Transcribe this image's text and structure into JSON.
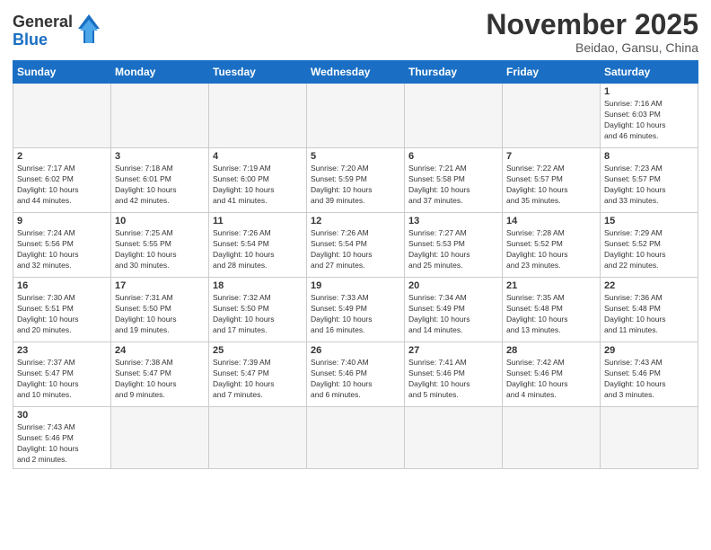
{
  "header": {
    "logo_general": "General",
    "logo_blue": "Blue",
    "month_title": "November 2025",
    "location": "Beidao, Gansu, China"
  },
  "weekdays": [
    "Sunday",
    "Monday",
    "Tuesday",
    "Wednesday",
    "Thursday",
    "Friday",
    "Saturday"
  ],
  "weeks": [
    [
      {
        "day": "",
        "info": ""
      },
      {
        "day": "",
        "info": ""
      },
      {
        "day": "",
        "info": ""
      },
      {
        "day": "",
        "info": ""
      },
      {
        "day": "",
        "info": ""
      },
      {
        "day": "",
        "info": ""
      },
      {
        "day": "1",
        "info": "Sunrise: 7:16 AM\nSunset: 6:03 PM\nDaylight: 10 hours\nand 46 minutes."
      }
    ],
    [
      {
        "day": "2",
        "info": "Sunrise: 7:17 AM\nSunset: 6:02 PM\nDaylight: 10 hours\nand 44 minutes."
      },
      {
        "day": "3",
        "info": "Sunrise: 7:18 AM\nSunset: 6:01 PM\nDaylight: 10 hours\nand 42 minutes."
      },
      {
        "day": "4",
        "info": "Sunrise: 7:19 AM\nSunset: 6:00 PM\nDaylight: 10 hours\nand 41 minutes."
      },
      {
        "day": "5",
        "info": "Sunrise: 7:20 AM\nSunset: 5:59 PM\nDaylight: 10 hours\nand 39 minutes."
      },
      {
        "day": "6",
        "info": "Sunrise: 7:21 AM\nSunset: 5:58 PM\nDaylight: 10 hours\nand 37 minutes."
      },
      {
        "day": "7",
        "info": "Sunrise: 7:22 AM\nSunset: 5:57 PM\nDaylight: 10 hours\nand 35 minutes."
      },
      {
        "day": "8",
        "info": "Sunrise: 7:23 AM\nSunset: 5:57 PM\nDaylight: 10 hours\nand 33 minutes."
      }
    ],
    [
      {
        "day": "9",
        "info": "Sunrise: 7:24 AM\nSunset: 5:56 PM\nDaylight: 10 hours\nand 32 minutes."
      },
      {
        "day": "10",
        "info": "Sunrise: 7:25 AM\nSunset: 5:55 PM\nDaylight: 10 hours\nand 30 minutes."
      },
      {
        "day": "11",
        "info": "Sunrise: 7:26 AM\nSunset: 5:54 PM\nDaylight: 10 hours\nand 28 minutes."
      },
      {
        "day": "12",
        "info": "Sunrise: 7:26 AM\nSunset: 5:54 PM\nDaylight: 10 hours\nand 27 minutes."
      },
      {
        "day": "13",
        "info": "Sunrise: 7:27 AM\nSunset: 5:53 PM\nDaylight: 10 hours\nand 25 minutes."
      },
      {
        "day": "14",
        "info": "Sunrise: 7:28 AM\nSunset: 5:52 PM\nDaylight: 10 hours\nand 23 minutes."
      },
      {
        "day": "15",
        "info": "Sunrise: 7:29 AM\nSunset: 5:52 PM\nDaylight: 10 hours\nand 22 minutes."
      }
    ],
    [
      {
        "day": "16",
        "info": "Sunrise: 7:30 AM\nSunset: 5:51 PM\nDaylight: 10 hours\nand 20 minutes."
      },
      {
        "day": "17",
        "info": "Sunrise: 7:31 AM\nSunset: 5:50 PM\nDaylight: 10 hours\nand 19 minutes."
      },
      {
        "day": "18",
        "info": "Sunrise: 7:32 AM\nSunset: 5:50 PM\nDaylight: 10 hours\nand 17 minutes."
      },
      {
        "day": "19",
        "info": "Sunrise: 7:33 AM\nSunset: 5:49 PM\nDaylight: 10 hours\nand 16 minutes."
      },
      {
        "day": "20",
        "info": "Sunrise: 7:34 AM\nSunset: 5:49 PM\nDaylight: 10 hours\nand 14 minutes."
      },
      {
        "day": "21",
        "info": "Sunrise: 7:35 AM\nSunset: 5:48 PM\nDaylight: 10 hours\nand 13 minutes."
      },
      {
        "day": "22",
        "info": "Sunrise: 7:36 AM\nSunset: 5:48 PM\nDaylight: 10 hours\nand 11 minutes."
      }
    ],
    [
      {
        "day": "23",
        "info": "Sunrise: 7:37 AM\nSunset: 5:47 PM\nDaylight: 10 hours\nand 10 minutes."
      },
      {
        "day": "24",
        "info": "Sunrise: 7:38 AM\nSunset: 5:47 PM\nDaylight: 10 hours\nand 9 minutes."
      },
      {
        "day": "25",
        "info": "Sunrise: 7:39 AM\nSunset: 5:47 PM\nDaylight: 10 hours\nand 7 minutes."
      },
      {
        "day": "26",
        "info": "Sunrise: 7:40 AM\nSunset: 5:46 PM\nDaylight: 10 hours\nand 6 minutes."
      },
      {
        "day": "27",
        "info": "Sunrise: 7:41 AM\nSunset: 5:46 PM\nDaylight: 10 hours\nand 5 minutes."
      },
      {
        "day": "28",
        "info": "Sunrise: 7:42 AM\nSunset: 5:46 PM\nDaylight: 10 hours\nand 4 minutes."
      },
      {
        "day": "29",
        "info": "Sunrise: 7:43 AM\nSunset: 5:46 PM\nDaylight: 10 hours\nand 3 minutes."
      }
    ],
    [
      {
        "day": "30",
        "info": "Sunrise: 7:43 AM\nSunset: 5:46 PM\nDaylight: 10 hours\nand 2 minutes."
      },
      {
        "day": "",
        "info": ""
      },
      {
        "day": "",
        "info": ""
      },
      {
        "day": "",
        "info": ""
      },
      {
        "day": "",
        "info": ""
      },
      {
        "day": "",
        "info": ""
      },
      {
        "day": "",
        "info": ""
      }
    ]
  ]
}
